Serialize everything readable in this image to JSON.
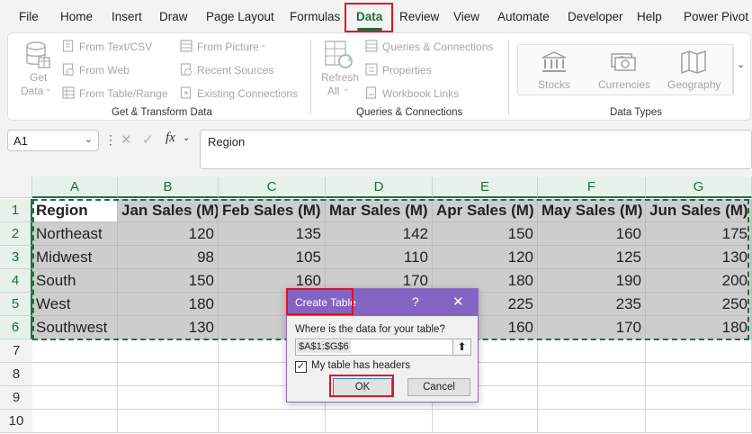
{
  "menu": {
    "tabs": [
      "File",
      "Home",
      "Insert",
      "Draw",
      "Page Layout",
      "Formulas",
      "Data",
      "Review",
      "View",
      "Automate",
      "Developer",
      "Help",
      "Power Pivot"
    ],
    "active_tab": "Data"
  },
  "ribbon": {
    "get_transform": {
      "get_data_line1": "Get",
      "get_data_line2": "Data",
      "from_text_csv": "From Text/CSV",
      "from_web": "From Web",
      "from_table_range": "From Table/Range",
      "from_picture": "From Picture",
      "recent_sources": "Recent Sources",
      "existing_connections": "Existing Connections",
      "label": "Get & Transform Data"
    },
    "queries": {
      "refresh_line1": "Refresh",
      "refresh_line2": "All",
      "queries_connections": "Queries & Connections",
      "properties": "Properties",
      "workbook_links": "Workbook Links",
      "label": "Queries & Connections"
    },
    "data_types": {
      "stocks": "Stocks",
      "currencies": "Currencies",
      "geography": "Geography",
      "label": "Data Types"
    }
  },
  "formula_bar": {
    "name_box": "A1",
    "formula": "Region",
    "fx": "fx"
  },
  "sheet": {
    "columns": [
      "A",
      "B",
      "C",
      "D",
      "E",
      "F",
      "G"
    ],
    "rows": [
      "1",
      "2",
      "3",
      "4",
      "5",
      "6",
      "7",
      "8",
      "9",
      "10"
    ],
    "header": [
      "Region",
      "Jan Sales (M)",
      "Feb Sales (M)",
      "Mar Sales (M)",
      "Apr Sales (M)",
      "May Sales (M)",
      "Jun Sales (M)"
    ],
    "data": [
      [
        "Northeast",
        "120",
        "135",
        "142",
        "150",
        "160",
        "175"
      ],
      [
        "Midwest",
        "98",
        "105",
        "110",
        "120",
        "125",
        "130"
      ],
      [
        "South",
        "150",
        "160",
        "170",
        "180",
        "190",
        "200"
      ],
      [
        "West",
        "180",
        "",
        "",
        "225",
        "235",
        "250"
      ],
      [
        "Southwest",
        "130",
        "",
        "",
        "160",
        "170",
        "180"
      ]
    ]
  },
  "dialog": {
    "title": "Create Table",
    "help": "?",
    "close": "✕",
    "prompt": "Where is the data for your table?",
    "range": "$A$1:$G$6",
    "checkbox_label": "My table has headers",
    "checkbox_checked": true,
    "ok": "OK",
    "cancel": "Cancel"
  },
  "colors": {
    "accent_green": "#1e7145",
    "dialog_purple": "#8563c3",
    "highlight_red": "#e0141e"
  }
}
